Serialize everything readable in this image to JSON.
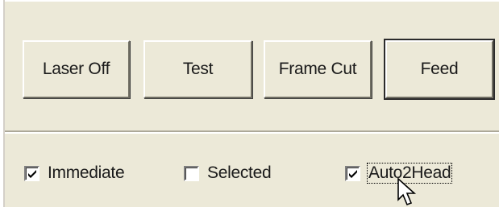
{
  "toolbar": {
    "buttons": [
      {
        "label": "Laser Off"
      },
      {
        "label": "Test"
      },
      {
        "label": "Frame Cut"
      },
      {
        "label": "Feed",
        "default": true
      }
    ]
  },
  "options": {
    "immediate": {
      "label": "Immediate",
      "checked": true
    },
    "selected": {
      "label": "Selected",
      "checked": false
    },
    "auto2head": {
      "label": "Auto2Head",
      "checked": true,
      "focused": true
    }
  },
  "cursor": {
    "icon": "arrow-cursor-icon"
  }
}
